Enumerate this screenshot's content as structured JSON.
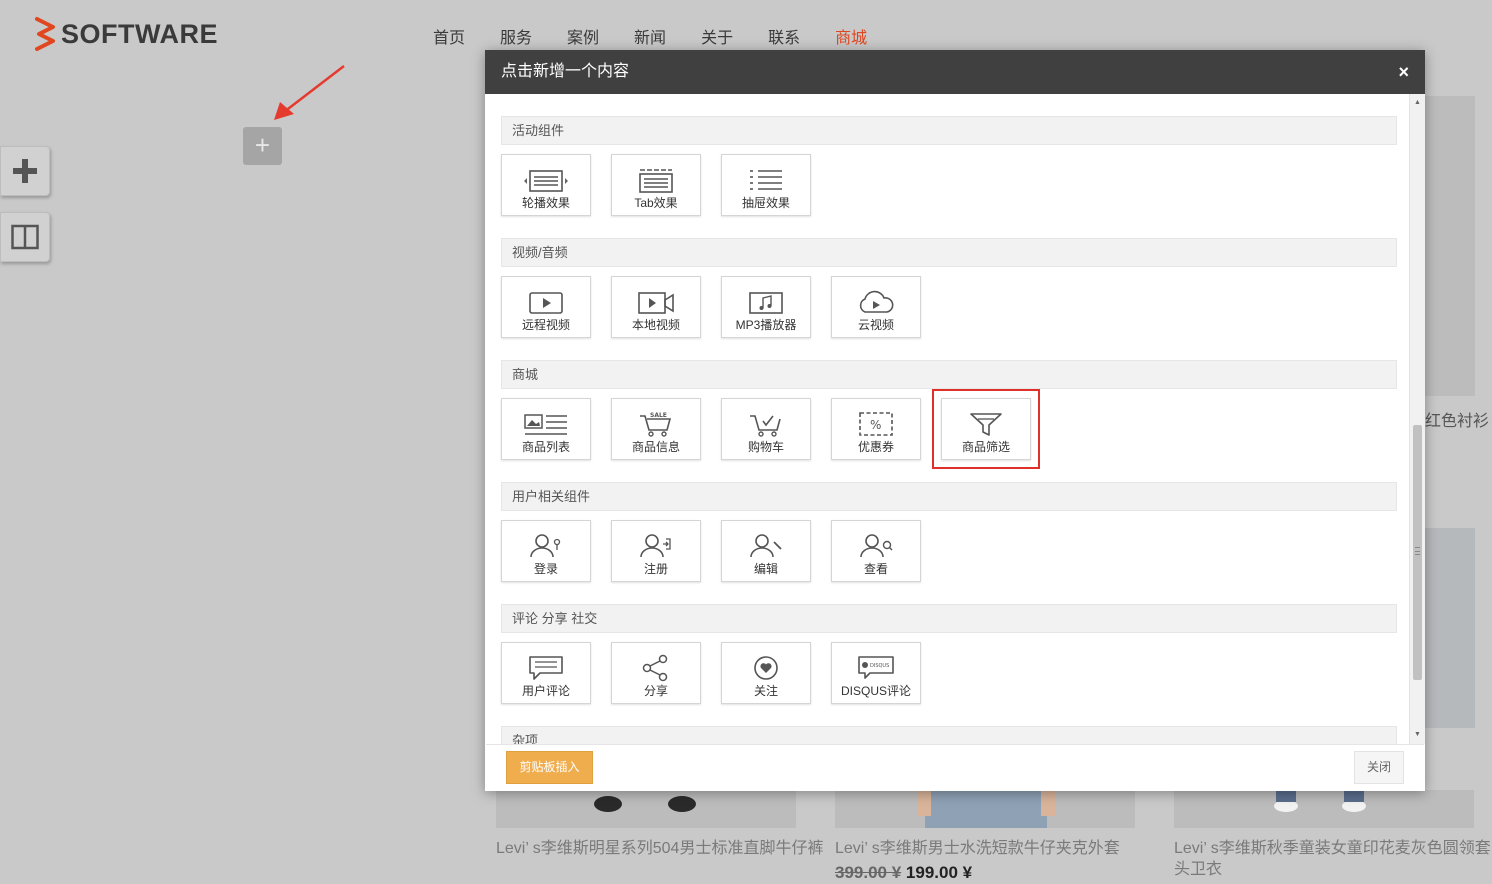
{
  "site": {
    "logo_text": "SOFTWARE",
    "nav": [
      "首页",
      "服务",
      "案例",
      "新闻",
      "关于",
      "联系",
      "商城"
    ],
    "nav_active": "商城"
  },
  "products": [
    {
      "name": "Levi’ s李维斯明星系列504男士标准直脚牛仔裤"
    },
    {
      "name": "Levi’ s李维斯男士水洗短款牛仔夹克外套",
      "old_price": "399.00 ¥",
      "price": "199.00 ¥"
    },
    {
      "name": "Levi’ s李维斯秋季童装女童印花麦灰色圆领套头卫衣"
    }
  ],
  "right_partial_text": "红色衬衫",
  "modal": {
    "title": "点击新增一个内容",
    "close_symbol": "×",
    "sections": [
      {
        "title": "活动组件",
        "items": [
          {
            "label": "轮播效果",
            "icon": "carousel-icon"
          },
          {
            "label": "Tab效果",
            "icon": "tab-icon"
          },
          {
            "label": "抽屉效果",
            "icon": "drawer-icon"
          }
        ]
      },
      {
        "title": "视频/音频",
        "items": [
          {
            "label": "远程视频",
            "icon": "remote-video-icon"
          },
          {
            "label": "本地视频",
            "icon": "local-video-icon"
          },
          {
            "label": "MP3播放器",
            "icon": "mp3-player-icon"
          },
          {
            "label": "云视频",
            "icon": "cloud-video-icon"
          }
        ]
      },
      {
        "title": "商城",
        "items": [
          {
            "label": "商品列表",
            "icon": "product-list-icon"
          },
          {
            "label": "商品信息",
            "icon": "sale-cart-icon"
          },
          {
            "label": "购物车",
            "icon": "shopping-cart-icon"
          },
          {
            "label": "优惠券",
            "icon": "coupon-icon"
          },
          {
            "label": "商品筛选",
            "icon": "filter-icon"
          }
        ]
      },
      {
        "title": "用户相关组件",
        "items": [
          {
            "label": "登录",
            "icon": "user-login-icon"
          },
          {
            "label": "注册",
            "icon": "user-register-icon"
          },
          {
            "label": "编辑",
            "icon": "user-edit-icon"
          },
          {
            "label": "查看",
            "icon": "user-view-icon"
          }
        ]
      },
      {
        "title": "评论 分享 社交",
        "items": [
          {
            "label": "用户评论",
            "icon": "comment-icon"
          },
          {
            "label": "分享",
            "icon": "share-icon"
          },
          {
            "label": "关注",
            "icon": "follow-heart-icon"
          },
          {
            "label": "DISQUS评论",
            "icon": "disqus-icon"
          }
        ]
      },
      {
        "title": "杂项",
        "items": []
      }
    ],
    "highlighted_item": "商品筛选",
    "paste_button": "剪贴板插入",
    "close_button": "关闭"
  },
  "colors": {
    "accent": "#e0461f",
    "modal_header": "#404040",
    "paste_button": "#f0ad4e",
    "highlight_box": "#e0302a"
  }
}
